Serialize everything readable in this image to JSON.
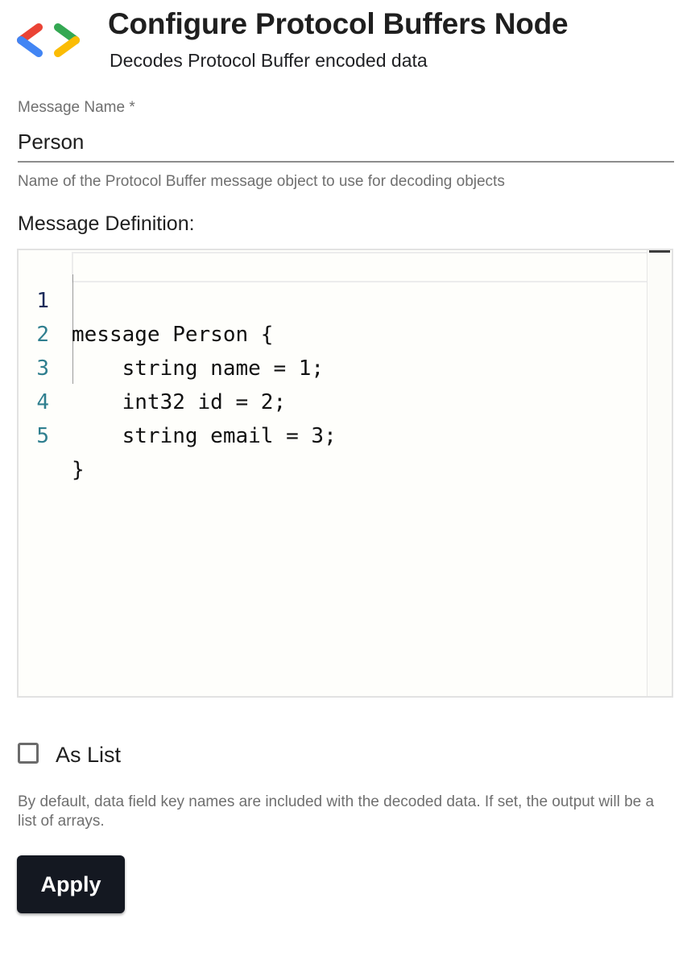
{
  "header": {
    "logo_icon": "google-developer-brackets-logo",
    "title": "Configure Protocol Buffers Node",
    "subtitle": "Decodes Protocol Buffer encoded data"
  },
  "message_name": {
    "label": "Message Name *",
    "value": "Person",
    "help": "Name of the Protocol Buffer message object to use for decoding objects"
  },
  "message_definition": {
    "label": "Message Definition:",
    "lines": [
      {
        "number": "1",
        "text": "message Person {"
      },
      {
        "number": "2",
        "text": "    string name = 1;"
      },
      {
        "number": "3",
        "text": "    int32 id = 2;"
      },
      {
        "number": "4",
        "text": "    string email = 3;"
      },
      {
        "number": "5",
        "text": "}"
      }
    ]
  },
  "as_list": {
    "label": "As List",
    "checked": false,
    "help": "By default, data field key names are included with the decoded data. If set, the output will be a list of arrays."
  },
  "actions": {
    "apply_label": "Apply"
  },
  "colors": {
    "logo_red": "#EA4335",
    "logo_blue": "#4285F4",
    "logo_green": "#34A853",
    "logo_yellow": "#FBBC04",
    "button_bg": "#141821"
  }
}
